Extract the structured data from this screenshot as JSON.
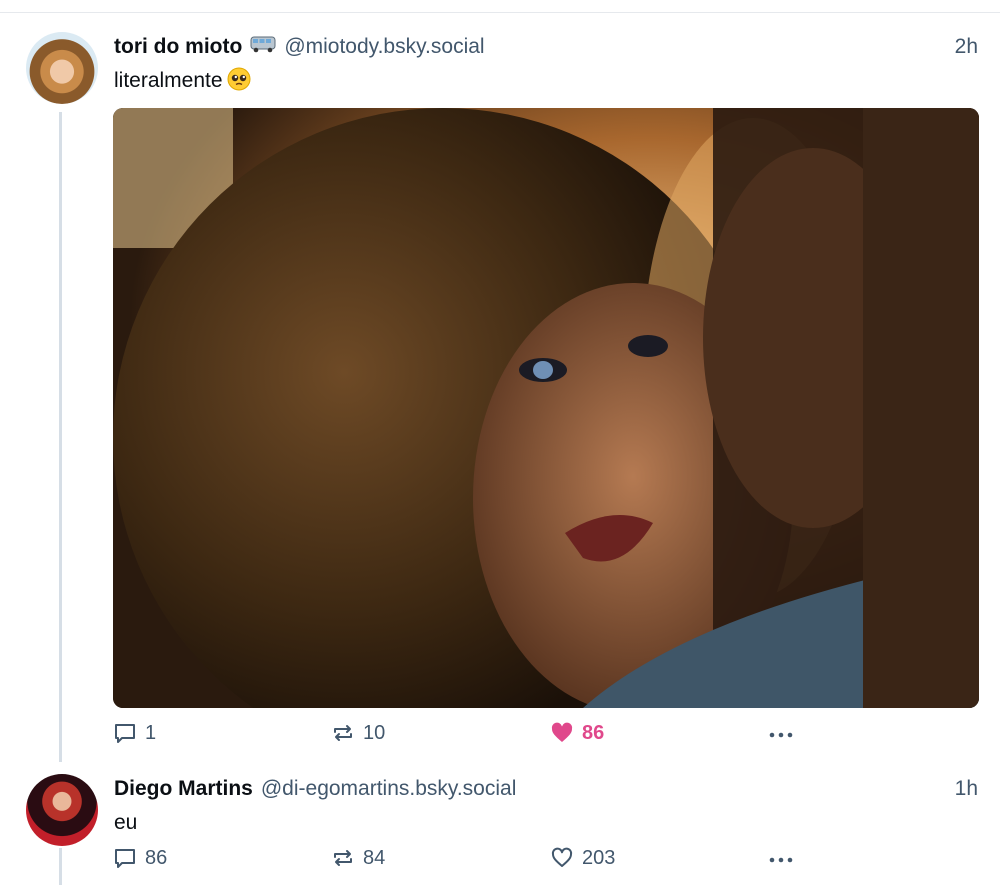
{
  "posts": [
    {
      "display_name": "tori do mioto",
      "name_emoji_icon": "bus-icon",
      "handle": "@miotody.bsky.social",
      "timestamp": "2h",
      "text": "literalmente",
      "text_emoji_icon": "pleading-face-emoji",
      "has_image": true,
      "replies": "1",
      "reposts": "10",
      "likes": "86",
      "liked": true
    },
    {
      "display_name": "Diego Martins",
      "handle": "@di-egomartins.bsky.social",
      "timestamp": "1h",
      "text": "eu",
      "replies": "86",
      "reposts": "84",
      "likes": "203",
      "liked": false
    }
  ],
  "colors": {
    "text_primary": "#0b0f14",
    "text_secondary": "#42576c",
    "like_active": "#e0488b",
    "thread_line": "#d6dee6",
    "divider": "#e6e9ed"
  }
}
